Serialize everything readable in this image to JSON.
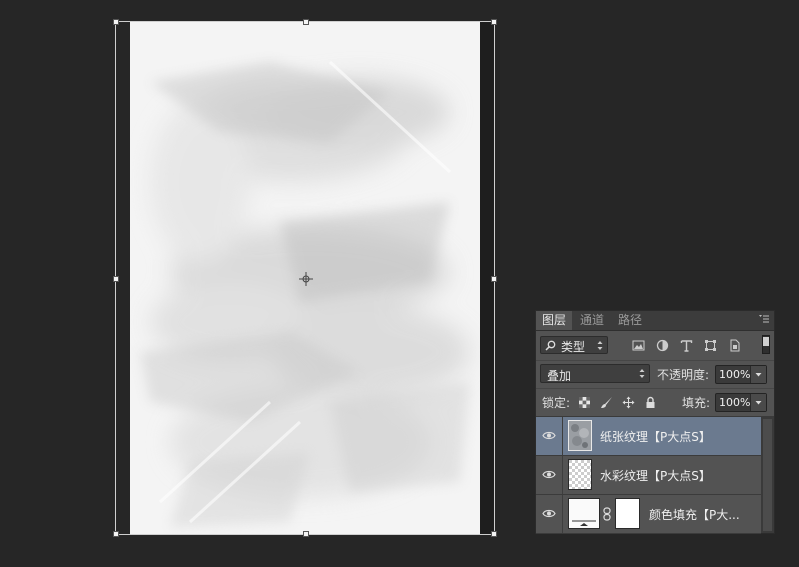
{
  "layers_panel": {
    "tabs": [
      "图层",
      "通道",
      "路径"
    ],
    "active_tab": "图层",
    "filter": {
      "label": "类型",
      "icons": [
        "pixel-filter-icon",
        "adjustment-filter-icon",
        "text-filter-icon",
        "shape-filter-icon",
        "smart-object-filter-icon"
      ]
    },
    "blend_mode": "叠加",
    "opacity_label": "不透明度:",
    "opacity_value": "100%",
    "lock_label": "锁定:",
    "lock_icons": [
      "lock-transparent-icon",
      "lock-image-icon",
      "lock-position-icon",
      "lock-all-icon"
    ],
    "fill_label": "填充:",
    "fill_value": "100%",
    "layers": [
      {
        "name": "纸张纹理【P大点S】",
        "visible": true,
        "selected": true,
        "thumb": "paper-texture"
      },
      {
        "name": "水彩纹理【P大点S】",
        "visible": true,
        "selected": false,
        "thumb": "transparent"
      },
      {
        "name": "颜色填充【P大...",
        "visible": true,
        "selected": false,
        "thumb": "fill"
      }
    ]
  },
  "colors": {
    "workspace": "#262626",
    "panel": "#535353",
    "selected_layer": "#6b7a8f"
  }
}
